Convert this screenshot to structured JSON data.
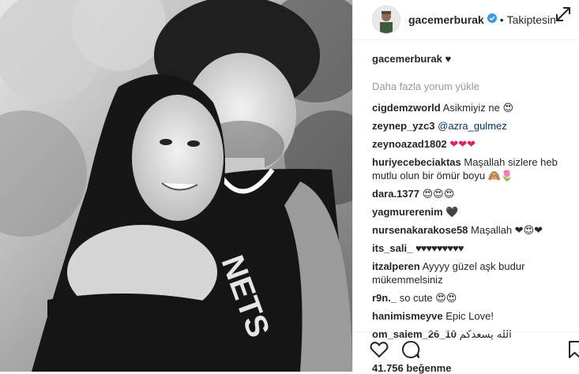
{
  "header": {
    "username": "gacemerburak",
    "follow_status": "Takiptesin"
  },
  "caption": {
    "username": "gacemerburak",
    "text": "♥"
  },
  "load_more": "Daha fazla yorum yükle",
  "comments": [
    {
      "user": "cigdemzworld",
      "text": "Asikmiyiz ne 😍"
    },
    {
      "user": "zeynep_yzc3",
      "text": "@azra_gulmez"
    },
    {
      "user": "zeynoazad1802",
      "text": "❤❤❤"
    },
    {
      "user": "huriyecebeciaktas",
      "text": "Maşallah sizlere heb mutlu olun bir ömür boyu 🙈🌷"
    },
    {
      "user": "dara.1377",
      "text": "😍😍😍"
    },
    {
      "user": "yagmurerenim",
      "text": "🖤"
    },
    {
      "user": "nursenakarakose58",
      "text": "Maşallah ❤😍❤"
    },
    {
      "user": "its_sali_",
      "text": "♥♥♥♥♥♥♥♥♥"
    },
    {
      "user": "itzalperen",
      "text": "Ayyyy güzel aşk budur mükemmelsiniz"
    },
    {
      "user": "r9n._",
      "text": "so cute 😍😍"
    },
    {
      "user": "hanimismeyve",
      "text": "Epic Love!"
    },
    {
      "user": "om_salem_26_10",
      "text": "الله يسعدكم"
    }
  ],
  "likes": "41.756 beğenme",
  "colors": {
    "verified": "#3897f0",
    "text": "#262626",
    "muted": "#999999",
    "mention": "#003569",
    "heart": "#e0245e"
  },
  "icons": [
    "verified-icon",
    "expand-icon",
    "heart-icon",
    "comment-icon",
    "bookmark-icon"
  ]
}
